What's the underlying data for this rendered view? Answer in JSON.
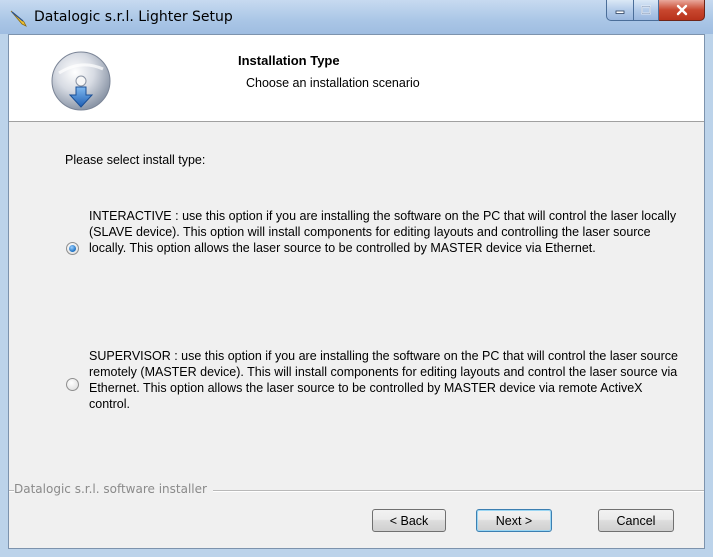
{
  "window": {
    "title": "Datalogic s.r.l. Lighter Setup",
    "app_icon": "lighter-feather-icon",
    "caption_buttons": [
      "minimize",
      "maximize",
      "close"
    ]
  },
  "header": {
    "title": "Installation Type",
    "subtitle": "Choose an installation scenario",
    "icon": "installer-disc-icon"
  },
  "prompt": "Please select install type:",
  "options": [
    {
      "id": "interactive",
      "selected": true,
      "text": "INTERACTIVE : use this option if you are installing the software on the PC that will control the laser locally (SLAVE device). This option will install components for editing layouts and controlling the laser source locally. This option allows the laser source to be controlled by MASTER device via Ethernet."
    },
    {
      "id": "supervisor",
      "selected": false,
      "text": "SUPERVISOR : use this option if you are installing the software on the PC that will control the laser source remotely (MASTER device). This will install components for editing layouts and control the laser source via Ethernet. This option allows the laser source to be controlled by MASTER device via remote ActiveX control."
    }
  ],
  "branding": "Datalogic s.r.l. software installer",
  "buttons": {
    "back": "< Back",
    "next": "Next >",
    "cancel": "Cancel"
  },
  "colors": {
    "titlebar": "#aac6e6",
    "close_button": "#c8472f",
    "radio_selected": "#1a6fc1",
    "dialog_background": "#f0f0f0"
  }
}
